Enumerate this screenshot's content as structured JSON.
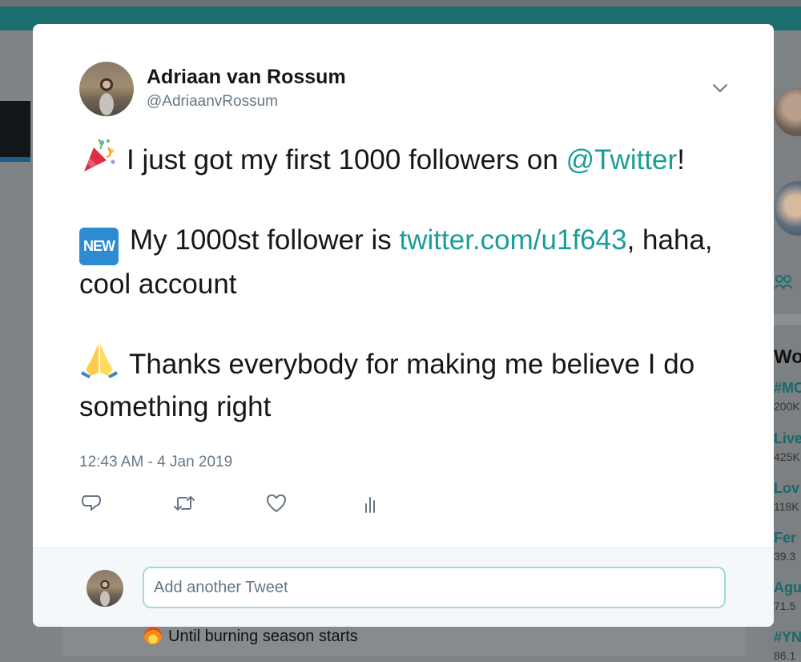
{
  "background": {
    "feed_text": "Until burning season starts",
    "trends_title": "Wo",
    "trends": [
      {
        "name": "#MC",
        "count": "200K"
      },
      {
        "name": "Live",
        "count": "425K"
      },
      {
        "name": "Lov",
        "count": "118K"
      },
      {
        "name": "Fer",
        "count": "39.3"
      },
      {
        "name": "Agu",
        "count": "71.5"
      },
      {
        "name": "#YN",
        "count": "86.1"
      }
    ]
  },
  "tweet": {
    "author_name": "Adriaan van Rossum",
    "author_handle": "@AdriaanvRossum",
    "line1_text": "I just got my first 1000 followers on",
    "line1_mention": "@Twitter",
    "line1_end": "!",
    "line2_emoji": "NEW",
    "line2_text": "My 1000st follower is",
    "line2_link": "twitter.com/u1f643",
    "line2_end": ",",
    "line2_cont": "haha, cool account",
    "line3_text": "Thanks everybody for making me believe I do something right",
    "timestamp": "12:43 AM - 4 Jan 2019"
  },
  "icons": {
    "reply": "reply-icon",
    "retweet": "retweet-icon",
    "like": "heart-icon",
    "analytics": "analytics-icon",
    "menu": "chevron-down-icon"
  },
  "reply": {
    "placeholder": "Add another Tweet"
  },
  "colors": {
    "link": "#1a9d99",
    "teal_header": "#1a6e70",
    "secondary_text": "#657786"
  }
}
